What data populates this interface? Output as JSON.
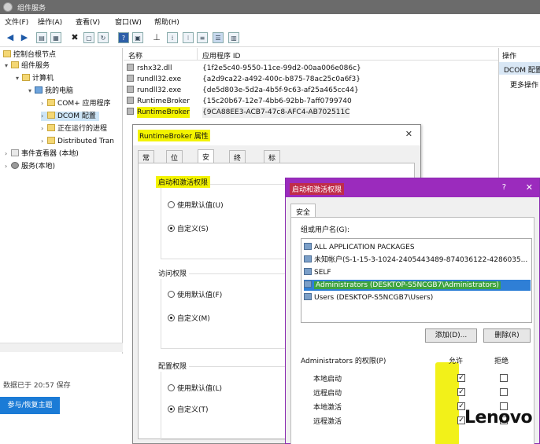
{
  "window": {
    "title": "组件服务"
  },
  "menu": [
    "文件(F)",
    "操作(A)",
    "查看(V)",
    "窗口(W)",
    "帮助(H)"
  ],
  "tree": {
    "items": [
      {
        "label": "控制台根节点",
        "icon": "folder-icon",
        "level": 0,
        "arrow": ""
      },
      {
        "label": "组件服务",
        "icon": "folder-icon",
        "level": 1,
        "arrow": "▾"
      },
      {
        "label": "计算机",
        "icon": "folder-icon",
        "level": 2,
        "arrow": "▾"
      },
      {
        "label": "我的电脑",
        "icon": "computer-icon",
        "level": 3,
        "arrow": "▾"
      },
      {
        "label": "COM+ 应用程序",
        "icon": "folder-icon",
        "level": 4,
        "arrow": "›"
      },
      {
        "label": "DCOM 配置",
        "icon": "folder-icon",
        "level": 4,
        "arrow": "›"
      },
      {
        "label": "正在运行的进程",
        "icon": "folder-icon",
        "level": 4,
        "arrow": "›"
      },
      {
        "label": "Distributed Tran",
        "icon": "folder-icon",
        "level": 4,
        "arrow": "›"
      },
      {
        "label": "事件查看器 (本地)",
        "icon": "event-viewer-icon",
        "level": 0,
        "arrow": "›"
      },
      {
        "label": "服务(本地)",
        "icon": "services-icon",
        "level": 0,
        "arrow": "›"
      }
    ]
  },
  "status": {
    "text": "数据已于 20:57 保存"
  },
  "restore_button": {
    "label": "参与/恢复主题"
  },
  "list": {
    "columns": [
      "名称",
      "应用程序 ID"
    ],
    "rows": [
      {
        "name": "rshx32.dll",
        "appid": "{1f2e5c40-9550-11ce-99d2-00aa006e086c}"
      },
      {
        "name": "rundll32.exe",
        "appid": "{a2d9ca22-a492-400c-b875-78ac25c0a6f3}"
      },
      {
        "name": "rundll32.exe",
        "appid": "{de5d803e-5d2a-4b5f-9c63-af25a465cc44}"
      },
      {
        "name": "RuntimeBroker",
        "appid": "{15c20b67-12e7-4bb6-92bb-7aff0799740"
      },
      {
        "name": "RuntimeBroker",
        "appid": "{9CA88EE3-ACB7-47c8-AFC4-AB702511C"
      }
    ]
  },
  "actions": {
    "header": "操作",
    "sub": "DCOM 配置",
    "more": "更多操作"
  },
  "props_dialog": {
    "title": "RuntimeBroker 属性",
    "tabs": [
      "常规",
      "位置",
      "安全",
      "终结点",
      "标识"
    ],
    "active_tab": "安全",
    "groups": [
      {
        "label": "启动和激活权限",
        "options": [
          "使用默认值(U)",
          "自定义(S)"
        ],
        "selected": 1
      },
      {
        "label": "访问权限",
        "options": [
          "使用默认值(F)",
          "自定义(M)"
        ],
        "selected": 1
      },
      {
        "label": "配置权限",
        "options": [
          "使用默认值(L)",
          "自定义(T)"
        ],
        "selected": 1
      }
    ]
  },
  "launch_dialog": {
    "title": "启动和激活权限",
    "help": "?",
    "close": "✕",
    "tab": "安全",
    "group_label": "组或用户名(G):",
    "users": [
      {
        "label": "ALL APPLICATION PACKAGES",
        "selected": false
      },
      {
        "label": "未知帐户(S-1-15-3-1024-2405443489-874036122-4286035...",
        "selected": false
      },
      {
        "label": "SELF",
        "selected": false
      },
      {
        "label": "Administrators (DESKTOP-S5NCGB7\\Administrators)",
        "selected": true
      },
      {
        "label": "Users (DESKTOP-S5NCGB7\\Users)",
        "selected": false
      }
    ],
    "add_button": "添加(D)...",
    "remove_button": "删除(R)",
    "perm_label": "Administrators 的权限(P)",
    "allow_label": "允许",
    "deny_label": "拒绝",
    "permissions": [
      {
        "name": "本地启动",
        "allow": true,
        "deny": false
      },
      {
        "name": "远程启动",
        "allow": true,
        "deny": false
      },
      {
        "name": "本地激活",
        "allow": true,
        "deny": false
      },
      {
        "name": "远程激活",
        "allow": true,
        "deny": false
      }
    ]
  },
  "watermark": {
    "text": "Lenovo"
  },
  "colors": {
    "highlight": "#f3f300",
    "launch_title": "#9b2bbd",
    "selection": "#2f7fd6"
  }
}
